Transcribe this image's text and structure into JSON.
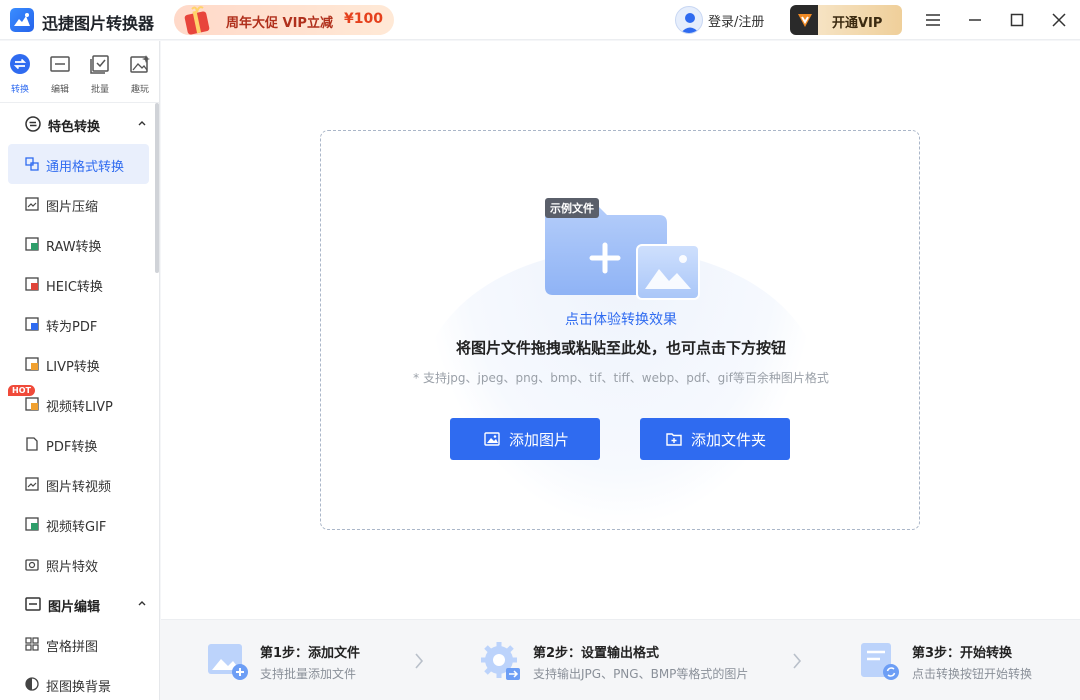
{
  "app": {
    "title": "迅捷图片转换器"
  },
  "promo": {
    "text": "周年大促 VIP立减",
    "price": "¥100"
  },
  "account": {
    "login_label": "登录/注册",
    "vip_label": "开通VIP"
  },
  "tabs": [
    {
      "label": "转换",
      "icon": "convert-icon"
    },
    {
      "label": "编辑",
      "icon": "edit-icon"
    },
    {
      "label": "批量",
      "icon": "batch-icon"
    },
    {
      "label": "趣玩",
      "icon": "fun-icon"
    }
  ],
  "sidebar": {
    "section1": {
      "label": "特色转换"
    },
    "items": [
      {
        "label": "通用格式转换"
      },
      {
        "label": "图片压缩"
      },
      {
        "label": "RAW转换"
      },
      {
        "label": "HEIC转换"
      },
      {
        "label": "转为PDF"
      },
      {
        "label": "LIVP转换"
      },
      {
        "label": "视频转LIVP"
      },
      {
        "label": "PDF转换"
      },
      {
        "label": "图片转视频"
      },
      {
        "label": "视频转GIF"
      },
      {
        "label": "照片特效"
      }
    ],
    "hot_badge": "HOT",
    "section2": {
      "label": "图片编辑"
    },
    "items2": [
      {
        "label": "宫格拼图"
      },
      {
        "label": "抠图换背景"
      }
    ]
  },
  "dropzone": {
    "sample_tag": "示例文件",
    "experience_link": "点击体验转换效果",
    "headline": "将图片文件拖拽或粘贴至此处，也可点击下方按钮",
    "formats": "* 支持jpg、jpeg、png、bmp、tif、tiff、webp、pdf、gif等百余种图片格式",
    "add_image": "添加图片",
    "add_folder": "添加文件夹"
  },
  "steps": [
    {
      "title": "第1步：添加文件",
      "sub": "支持批量添加文件"
    },
    {
      "title": "第2步：设置输出格式",
      "sub": "支持输出JPG、PNG、BMP等格式的图片"
    },
    {
      "title": "第3步：开始转换",
      "sub": "点击转换按钮开始转换"
    }
  ],
  "colors": {
    "accent": "#2f6bf0",
    "active_bg": "#e9effc",
    "hot": "#f04a3a"
  }
}
